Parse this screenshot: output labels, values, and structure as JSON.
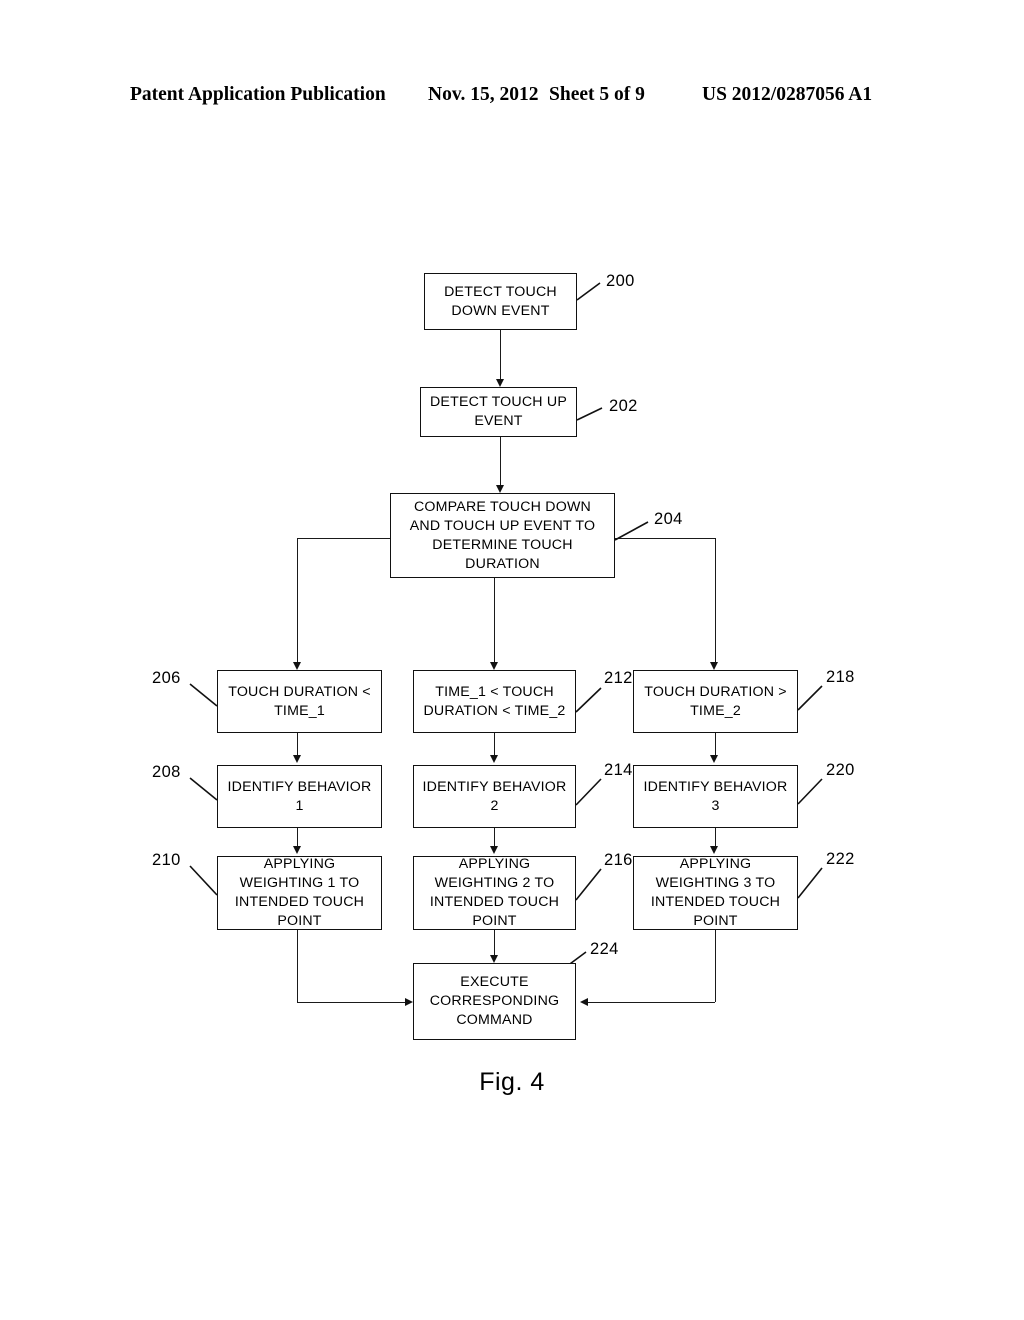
{
  "header": {
    "publication": "Patent Application Publication",
    "date": "Nov. 15, 2012",
    "sheet": "Sheet 5 of 9",
    "patent_number": "US 2012/0287056 A1"
  },
  "figure": {
    "caption": "Fig. 4"
  },
  "diagram": {
    "type": "flowchart",
    "nodes": [
      {
        "ref": "200",
        "line1": "DETECT TOUCH",
        "line2": "DOWN EVENT",
        "line3": "",
        "line4": ""
      },
      {
        "ref": "202",
        "line1": "DETECT TOUCH UP",
        "line2": "EVENT",
        "line3": "",
        "line4": ""
      },
      {
        "ref": "204",
        "line1": "COMPARE TOUCH DOWN",
        "line2": "AND TOUCH UP EVENT TO",
        "line3": "DETERMINE TOUCH",
        "line4": "DURATION"
      },
      {
        "ref": "206",
        "line1": "TOUCH DURATION <",
        "line2": "TIME_1",
        "line3": "",
        "line4": ""
      },
      {
        "ref": "208",
        "line1": "IDENTIFY BEHAVIOR",
        "line2": "1",
        "line3": "",
        "line4": ""
      },
      {
        "ref": "210",
        "line1": "APPLYING",
        "line2": "WEIGHTING 1 TO",
        "line3": "INTENDED TOUCH",
        "line4": "POINT"
      },
      {
        "ref": "212",
        "line1": "TIME_1 < TOUCH",
        "line2": "DURATION < TIME_2",
        "line3": "",
        "line4": ""
      },
      {
        "ref": "214",
        "line1": "IDENTIFY BEHAVIOR",
        "line2": "2",
        "line3": "",
        "line4": ""
      },
      {
        "ref": "216",
        "line1": "APPLYING",
        "line2": "WEIGHTING 2 TO",
        "line3": "INTENDED TOUCH",
        "line4": "POINT"
      },
      {
        "ref": "218",
        "line1": "TOUCH DURATION >",
        "line2": "TIME_2",
        "line3": "",
        "line4": ""
      },
      {
        "ref": "220",
        "line1": "IDENTIFY BEHAVIOR",
        "line2": "3",
        "line3": "",
        "line4": ""
      },
      {
        "ref": "222",
        "line1": "APPLYING",
        "line2": "WEIGHTING 3 TO",
        "line3": "INTENDED TOUCH",
        "line4": "POINT"
      },
      {
        "ref": "224",
        "line1": "EXECUTE",
        "line2": "CORRESPONDING",
        "line3": "COMMAND",
        "line4": ""
      }
    ]
  }
}
